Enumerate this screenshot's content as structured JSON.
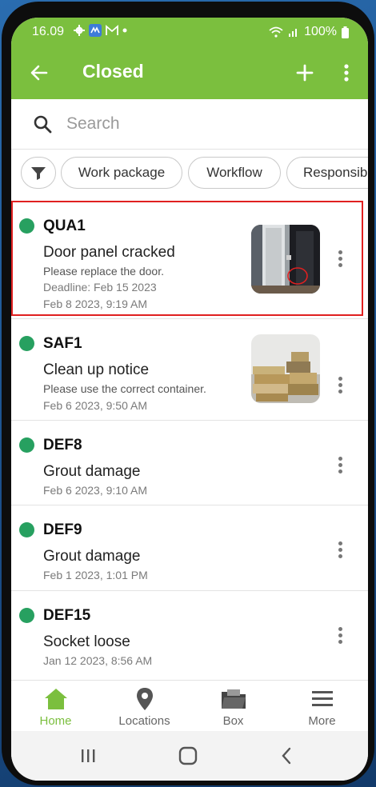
{
  "status_bar": {
    "time": "16.09",
    "battery": "100%"
  },
  "app_bar": {
    "title": "Closed"
  },
  "search": {
    "placeholder": "Search"
  },
  "filters": [
    "Work package",
    "Workflow",
    "Responsib"
  ],
  "items": [
    {
      "code": "QUA1",
      "title": "Door panel cracked",
      "description": "Please replace the door.",
      "deadline": "Deadline: Feb 15 2023",
      "date": "Feb 8 2023, 9:19 AM",
      "has_image": true,
      "image": "door-photo"
    },
    {
      "code": "SAF1",
      "title": "Clean up notice",
      "description": "Please use the correct container.",
      "date": "Feb 6 2023, 9:50 AM",
      "has_image": true,
      "image": "boxes-photo"
    },
    {
      "code": "DEF8",
      "title": "Grout damage",
      "date": "Feb 6 2023, 9:10 AM",
      "has_image": false
    },
    {
      "code": "DEF9",
      "title": "Grout damage",
      "date": "Feb 1 2023, 1:01 PM",
      "has_image": false
    },
    {
      "code": "DEF15",
      "title": "Socket loose",
      "date": "Jan 12 2023, 8:56 AM",
      "has_image": false
    }
  ],
  "bottom_nav": [
    {
      "label": "Home",
      "icon": "home-icon",
      "active": true
    },
    {
      "label": "Locations",
      "icon": "location-pin-icon",
      "active": false
    },
    {
      "label": "Box",
      "icon": "folder-icon",
      "active": false
    },
    {
      "label": "More",
      "icon": "menu-icon",
      "active": false
    }
  ],
  "colors": {
    "accent": "#7bbf3e",
    "status_dot": "#27a060",
    "selection": "#e02020"
  }
}
